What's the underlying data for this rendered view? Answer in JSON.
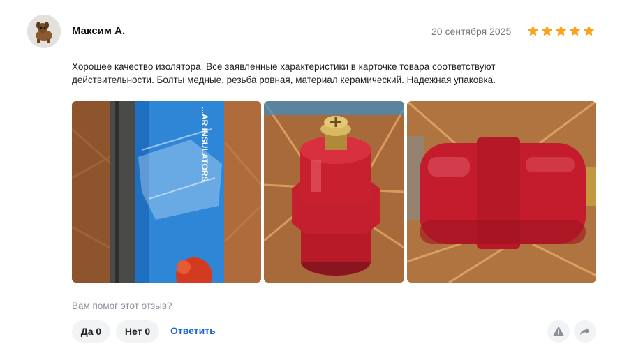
{
  "review": {
    "author": "Максим А.",
    "date": "20 сентября 2025",
    "rating": 5,
    "rating_max": 5,
    "text": "Хорошее качество изолятора. Все заявленные характеристики в карточке товара соответствуют действительности. Болты медные, резьба ровная, материал керамический. Надежная упаковка.",
    "photos": [
      {
        "label": "...AR INSULATORS"
      },
      {},
      {}
    ]
  },
  "feedback": {
    "question": "Вам помог этот отзыв?",
    "yes_label": "Да",
    "yes_count": "0",
    "no_label": "Нет",
    "no_count": "0",
    "reply_label": "Ответить"
  },
  "icons": {
    "star": "star-icon",
    "report": "warning-icon",
    "share": "share-arrow-icon"
  },
  "colors": {
    "star": "#f8a41a",
    "link": "#1d63d8",
    "muted": "#8a8f99",
    "button_bg": "#f2f3f5"
  }
}
